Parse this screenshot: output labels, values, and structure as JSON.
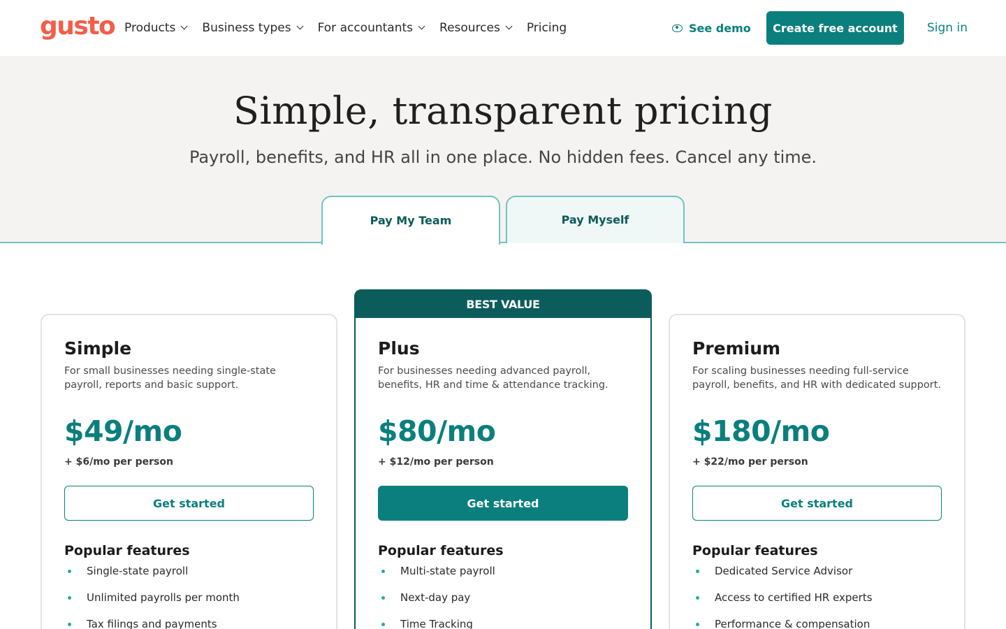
{
  "brand": {
    "logo_text": "gusto",
    "logo_color": "#f45d48",
    "accent": "#0b7f7d",
    "dark_accent": "#0d5c5c"
  },
  "nav": {
    "links": [
      {
        "label": "Products",
        "dropdown": true
      },
      {
        "label": "Business types",
        "dropdown": true
      },
      {
        "label": "For accountants",
        "dropdown": true
      },
      {
        "label": "Resources",
        "dropdown": true
      },
      {
        "label": "Pricing",
        "dropdown": false
      }
    ],
    "see_demo": "See demo",
    "create_account": "Create free account",
    "sign_in": "Sign in"
  },
  "hero": {
    "title": "Simple, transparent pricing",
    "subtitle": "Payroll, benefits, and HR all in one place. No hidden fees. Cancel any time.",
    "tabs": [
      {
        "label": "Pay My Team",
        "active": true
      },
      {
        "label": "Pay Myself",
        "active": false
      }
    ]
  },
  "plans": [
    {
      "name": "Simple",
      "description": "For small businesses needing single-state payroll, reports and basic support.",
      "price": "$49/mo",
      "per_person": "+ $6/mo per person",
      "button": "Get started",
      "features_title": "Popular features",
      "features": [
        "Single-state payroll",
        "Unlimited payrolls per month",
        "Tax filings and payments"
      ]
    },
    {
      "badge": "BEST VALUE",
      "name": "Plus",
      "description": "For businesses needing advanced payroll, benefits, HR and time & attendance tracking.",
      "price": "$80/mo",
      "per_person": "+ $12/mo per person",
      "button": "Get started",
      "features_title": "Popular features",
      "features": [
        "Multi-state payroll",
        "Next-day pay",
        "Time Tracking"
      ]
    },
    {
      "name": "Premium",
      "description": "For scaling businesses needing full-service payroll, benefits, and HR with dedicated support.",
      "price": "$180/mo",
      "per_person": "+ $22/mo per person",
      "button": "Get started",
      "features_title": "Popular features",
      "features": [
        "Dedicated Service Advisor",
        "Access to certified HR experts",
        "Performance & compensation management"
      ]
    }
  ]
}
